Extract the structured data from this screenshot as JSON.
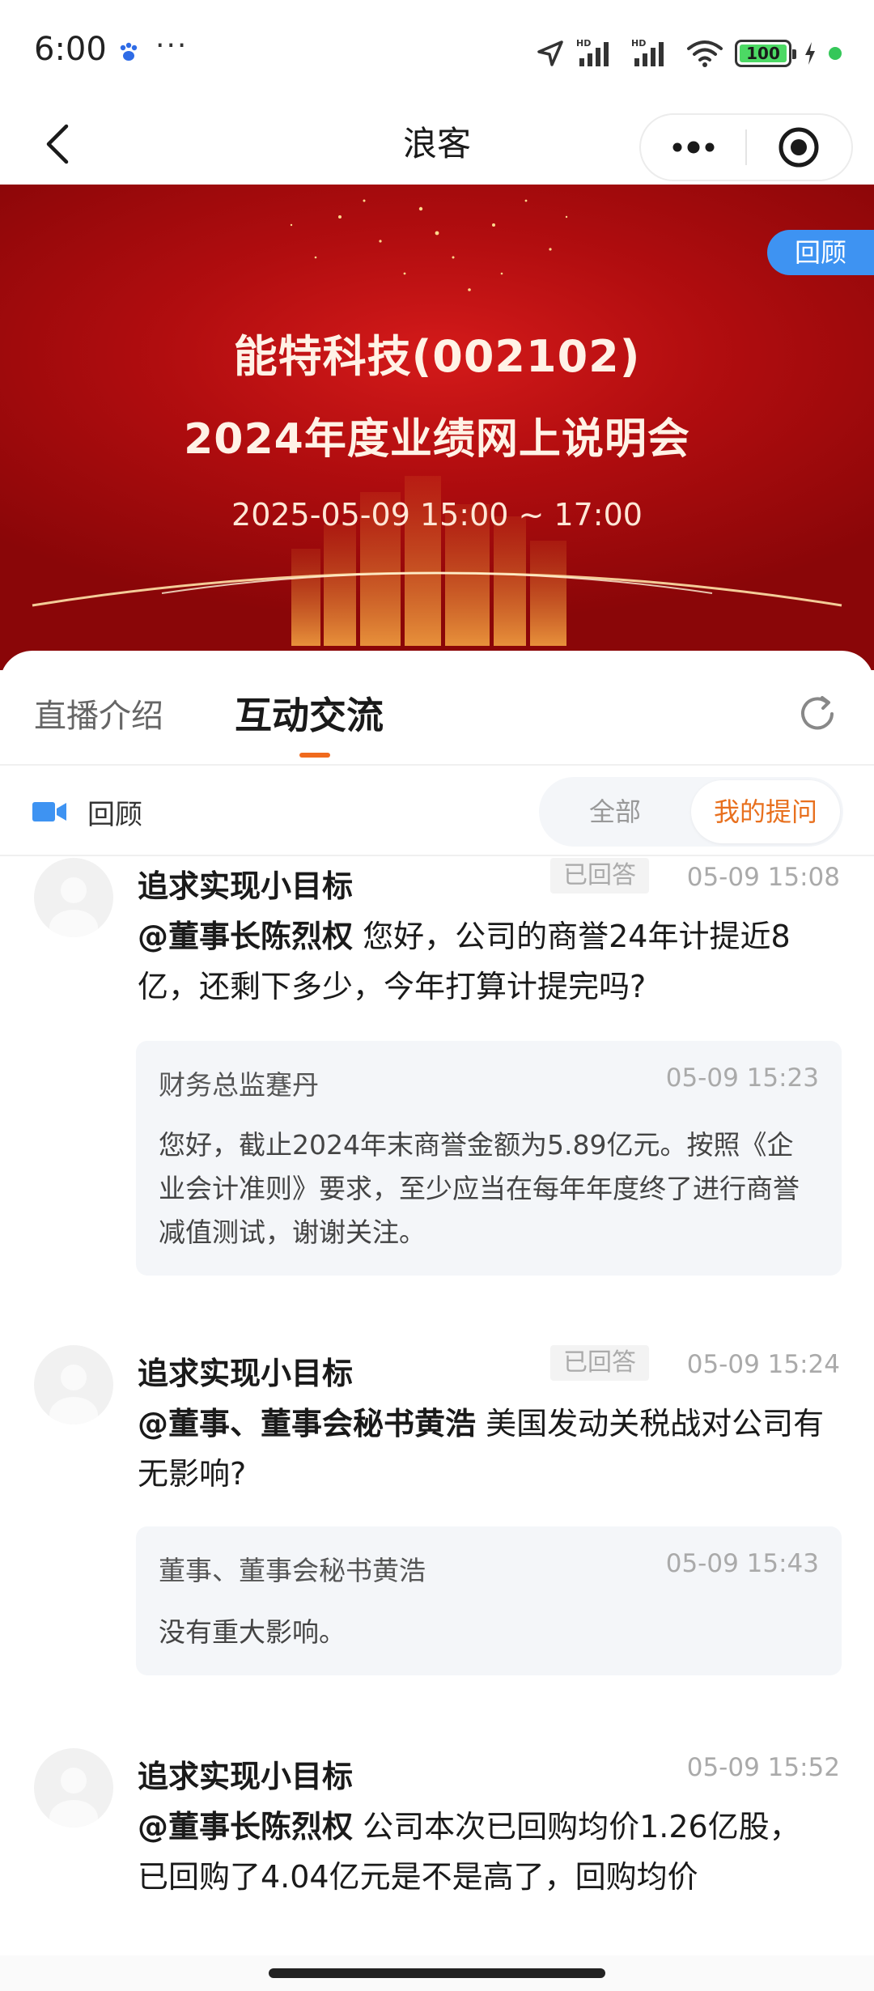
{
  "status_bar": {
    "time": "6:00",
    "more": "···",
    "battery": "100"
  },
  "title_bar": {
    "title": "浪客"
  },
  "banner": {
    "company": "能特科技(002102)",
    "event": "2024年度业绩网上说明会",
    "time": "2025-05-09 15:00 ~ 17:00",
    "badge": "回顾"
  },
  "tabs": [
    {
      "label": "直播介绍",
      "active": false
    },
    {
      "label": "互动交流",
      "active": true
    }
  ],
  "filter": {
    "replay_label": "回顾",
    "all_label": "全部",
    "mine_label": "我的提问",
    "selected": "我的提问"
  },
  "questions": [
    {
      "user": "追求实现小目标",
      "status": "已回答",
      "time": "05-09 15:08",
      "mention": "@董事长陈烈权",
      "text": "您好，公司的商誉24年计提近8亿，还剩下多少，今年打算计提完吗?",
      "answer": {
        "name": "财务总监蹇丹",
        "time": "05-09 15:23",
        "text": "您好，截止2024年末商誉金额为5.89亿元。按照《企业会计准则》要求，至少应当在每年年度终了进行商誉减值测试，谢谢关注。"
      }
    },
    {
      "user": "追求实现小目标",
      "status": "已回答",
      "time": "05-09 15:24",
      "mention": "@董事、董事会秘书黄浩",
      "text": "美国发动关税战对公司有无影响?",
      "answer": {
        "name": "董事、董事会秘书黄浩",
        "time": "05-09 15:43",
        "text": "没有重大影响。"
      }
    },
    {
      "user": "追求实现小目标",
      "status": "",
      "time": "05-09 15:52",
      "mention": "@董事长陈烈权",
      "text": "公司本次已回购均价1.26亿股，已回购了4.04亿元是不是高了，回购均价"
    }
  ],
  "colors": {
    "accent": "#f06a1d",
    "banner_red": "#b10d0f",
    "badge_blue": "#3e93f2"
  }
}
